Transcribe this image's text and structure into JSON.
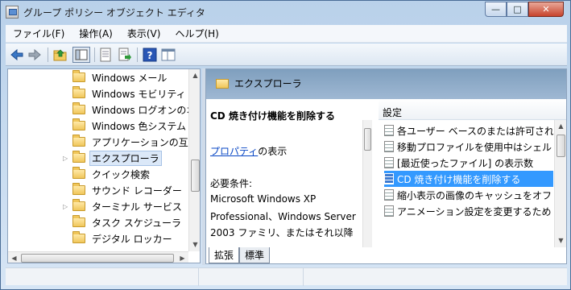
{
  "window": {
    "title": "グループ ポリシー オブジェクト エディタ",
    "minimize_glyph": "—",
    "maximize_glyph": "□",
    "close_glyph": "✕"
  },
  "menu": {
    "items": [
      "ファイル(F)",
      "操作(A)",
      "表示(V)",
      "ヘルプ(H)"
    ]
  },
  "toolbar": {
    "icons": [
      "back-icon",
      "forward-icon",
      "up-folder-icon",
      "show-hide-tree-icon",
      "properties-icon",
      "export-list-icon",
      "help-icon",
      "extended-view-icon"
    ]
  },
  "tree": {
    "items": [
      {
        "label": "Windows メール",
        "expandable": false,
        "selected": false
      },
      {
        "label": "Windows モビリティ セ",
        "expandable": false,
        "selected": false
      },
      {
        "label": "Windows ログオンのオ",
        "expandable": false,
        "selected": false
      },
      {
        "label": "Windows 色システム",
        "expandable": false,
        "selected": false
      },
      {
        "label": "アプリケーションの互",
        "expandable": false,
        "selected": false
      },
      {
        "label": "エクスプローラ",
        "expandable": true,
        "selected": true
      },
      {
        "label": "クイック検索",
        "expandable": false,
        "selected": false
      },
      {
        "label": "サウンド レコーダー",
        "expandable": false,
        "selected": false
      },
      {
        "label": "ターミナル サービス",
        "expandable": true,
        "selected": false
      },
      {
        "label": "タスク スケジューラ",
        "expandable": false,
        "selected": false
      },
      {
        "label": "デジタル ロッカー",
        "expandable": false,
        "selected": false
      }
    ]
  },
  "detail": {
    "section_title": "エクスプローラ",
    "policy_title": "CD 焼き付け機能を削除する",
    "properties_link": "プロパティ",
    "properties_suffix": "の表示",
    "requirements_label": "必要条件:",
    "requirements_lines": [
      "Microsoft Windows XP",
      "Professional、Windows Server",
      "2003 ファミリ、またはそれ以降"
    ]
  },
  "settings_list": {
    "column_header": "設定",
    "rows": [
      {
        "label": "各ユーザー ベースのまたは許可され",
        "selected": false
      },
      {
        "label": "移動プロファイルを使用中はシェル",
        "selected": false
      },
      {
        "label": "[最近使ったファイル] の表示数",
        "selected": false
      },
      {
        "label": "CD 焼き付け機能を削除する",
        "selected": true
      },
      {
        "label": "縮小表示の画像のキャッシュをオフ",
        "selected": false
      },
      {
        "label": "アニメーション設定を変更するため",
        "selected": false
      }
    ]
  },
  "tabs": {
    "extended": "拡張",
    "standard": "標準"
  },
  "scrollbars": {
    "up": "▲",
    "down": "▼",
    "left": "◀",
    "right": "▶"
  },
  "colors": {
    "selection": "#3399ff",
    "section_header": "#8fadc9",
    "link": "#0645c4"
  }
}
